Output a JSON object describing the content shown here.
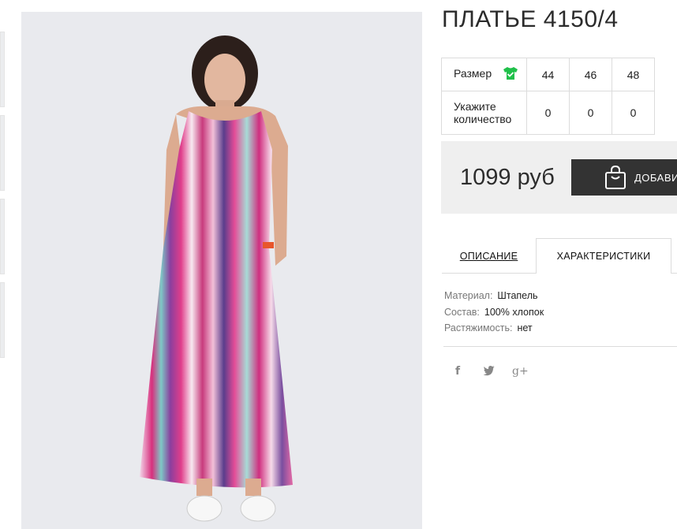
{
  "product": {
    "title": "ПЛАТЬЕ 4150/4"
  },
  "size_table": {
    "size_label": "Размер",
    "size_icon": "tshirt-check-icon",
    "sizes": [
      "44",
      "46",
      "48"
    ],
    "quantity_label": "Укажите количество",
    "quantities": [
      "0",
      "0",
      "0"
    ]
  },
  "purchase": {
    "price": "1099 руб",
    "add_button_label": "ДОБАВИТЬ",
    "add_button_icon": "shopping-bag-icon"
  },
  "tabs": [
    {
      "label": "ОПИСАНИЕ",
      "active": false
    },
    {
      "label": "ХАРАКТЕРИСТИКИ",
      "active": true
    }
  ],
  "characteristics": [
    {
      "key": "Материал:",
      "value": "Штапель"
    },
    {
      "key": "Состав:",
      "value": "100% хлопок"
    },
    {
      "key": "Растяжимость:",
      "value": "нет"
    }
  ],
  "social": [
    {
      "name": "facebook-icon",
      "glyph": "f"
    },
    {
      "name": "twitter-icon",
      "glyph": "🐦"
    },
    {
      "name": "google-plus-icon",
      "glyph": "g+"
    }
  ],
  "colors": {
    "button_bg": "#333333",
    "buybox_bg": "#efefef",
    "size_icon": "#20c04a",
    "photo_bg": "#e9eaee"
  }
}
